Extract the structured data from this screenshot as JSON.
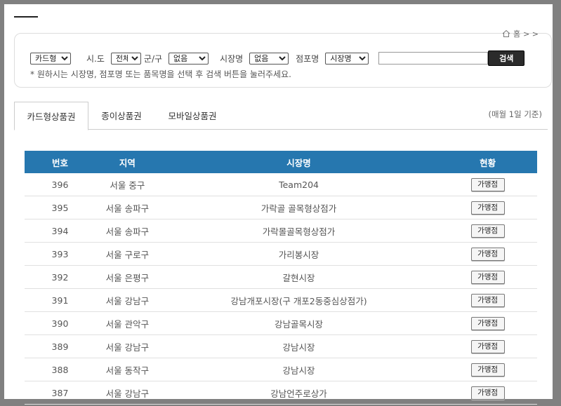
{
  "breadcrumb": {
    "home_label": "홈",
    "arrows": "> >"
  },
  "filters": {
    "card_type": "카드형",
    "sido_label": "시.도",
    "sido_value": "전체",
    "gungu_label": "군/구",
    "gungu_value": "없음",
    "market_label": "시장명",
    "market_value": "없음",
    "store_label": "점포명",
    "store_select": "시장명",
    "search_value": "",
    "search_button": "검색",
    "note": "* 원하시는 시장명, 점포명 또는 품목명을 선택 후 검색 버튼을 눌러주세요."
  },
  "tabs": [
    {
      "label": "카드형상품권"
    },
    {
      "label": "종이상품권"
    },
    {
      "label": "모바일상품권"
    }
  ],
  "basis": "(매월 1일 기준)",
  "table": {
    "headers": [
      "번호",
      "지역",
      "시장명",
      "현황"
    ],
    "rows": [
      {
        "no": "396",
        "region": "서울 중구",
        "market": "Team204",
        "status": "가맹점"
      },
      {
        "no": "395",
        "region": "서울 송파구",
        "market": "가락골 골목형상점가",
        "status": "가맹점"
      },
      {
        "no": "394",
        "region": "서울 송파구",
        "market": "가락몰골목형상점가",
        "status": "가맹점"
      },
      {
        "no": "393",
        "region": "서울 구로구",
        "market": "가리봉시장",
        "status": "가맹점"
      },
      {
        "no": "392",
        "region": "서울 은평구",
        "market": "갈현시장",
        "status": "가맹점"
      },
      {
        "no": "391",
        "region": "서울 강남구",
        "market": "강남개포시장(구 개포2동중심상점가)",
        "status": "가맹점"
      },
      {
        "no": "390",
        "region": "서울 관악구",
        "market": "강남골목시장",
        "status": "가맹점"
      },
      {
        "no": "389",
        "region": "서울 강남구",
        "market": "강남시장",
        "status": "가맹점"
      },
      {
        "no": "388",
        "region": "서울 동작구",
        "market": "강남시장",
        "status": "가맹점"
      },
      {
        "no": "387",
        "region": "서울 강남구",
        "market": "강남언주로상가",
        "status": "가맹점"
      }
    ]
  }
}
